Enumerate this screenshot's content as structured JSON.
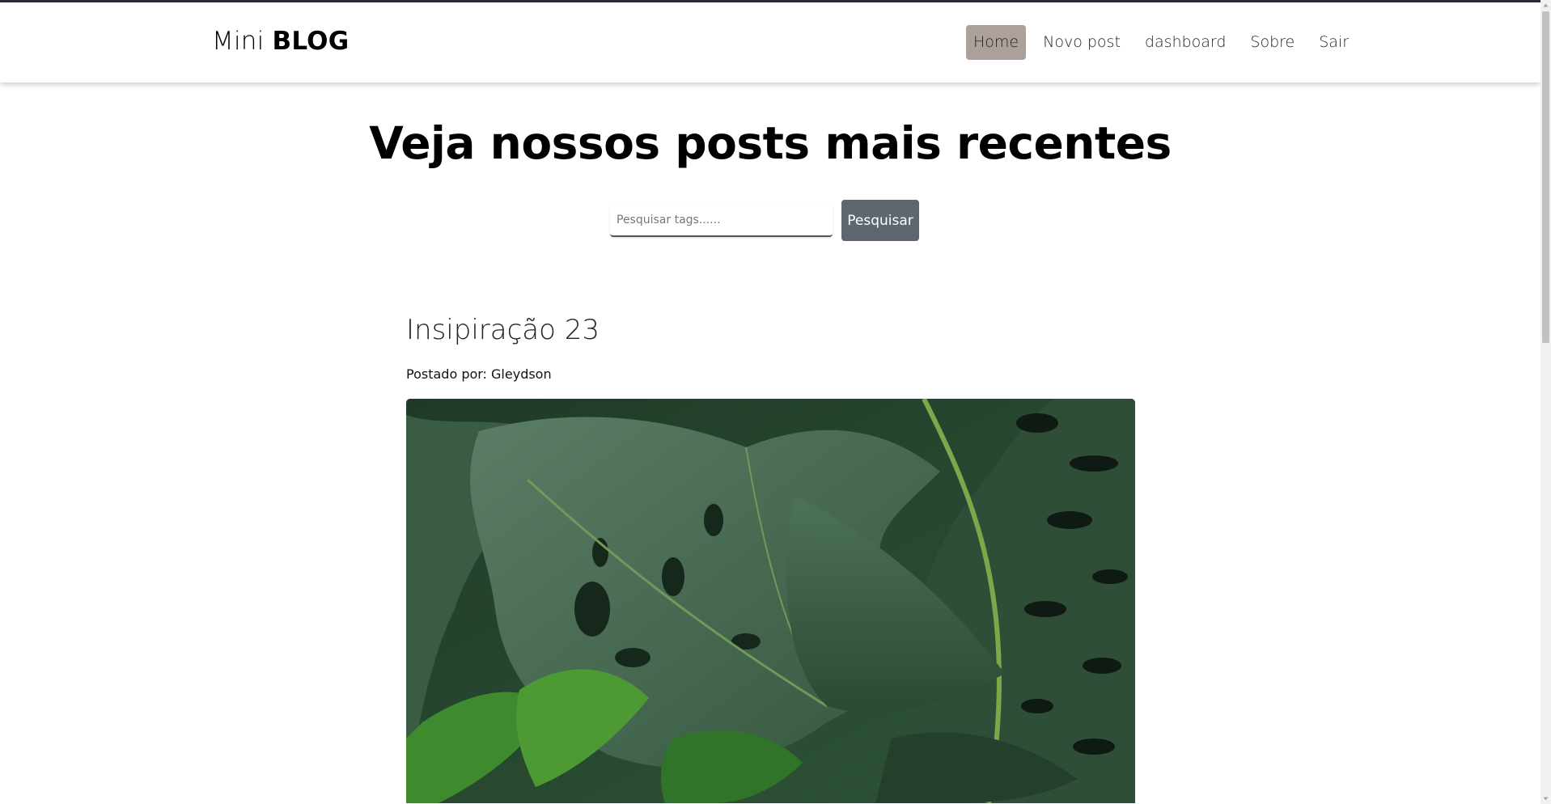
{
  "brand": {
    "light": "Mini",
    "bold": "BLOG"
  },
  "nav": {
    "items": [
      {
        "label": "Home",
        "active": true
      },
      {
        "label": "Novo post",
        "active": false
      },
      {
        "label": "dashboard",
        "active": false
      },
      {
        "label": "Sobre",
        "active": false
      },
      {
        "label": "Sair",
        "active": false
      }
    ]
  },
  "hero": {
    "title": "Veja nossos posts mais recentes"
  },
  "search": {
    "placeholder": "Pesquisar tags......",
    "value": "",
    "button_label": "Pesquisar"
  },
  "post": {
    "title": "Insipiração 23",
    "author": "Postado por: Gleydson",
    "image": "monstera-leaves-photo"
  },
  "colors": {
    "nav_active": "#aba19a",
    "button": "#5e6770",
    "leaf_dark": "#2d4a34"
  }
}
